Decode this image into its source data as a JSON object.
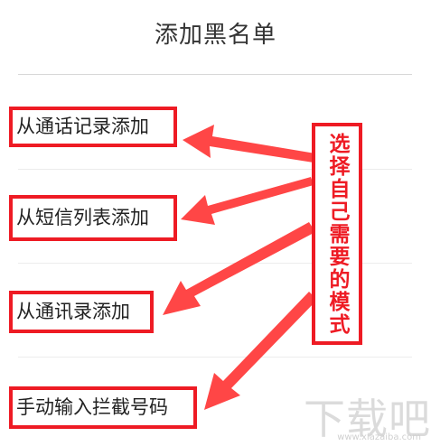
{
  "page": {
    "title": "添加黑名单"
  },
  "options": [
    {
      "label": "从通话记录添加"
    },
    {
      "label": "从短信列表添加"
    },
    {
      "label": "从通讯录添加"
    },
    {
      "label": "手动输入拦截号码"
    }
  ],
  "annotation": {
    "text": "选择自己需要的模式"
  },
  "watermark": {
    "text": "下载吧",
    "subtext": "www.xiazaiba.com"
  },
  "colors": {
    "highlight_red": "#ee1b24",
    "arrow_red": "#ff4646"
  }
}
